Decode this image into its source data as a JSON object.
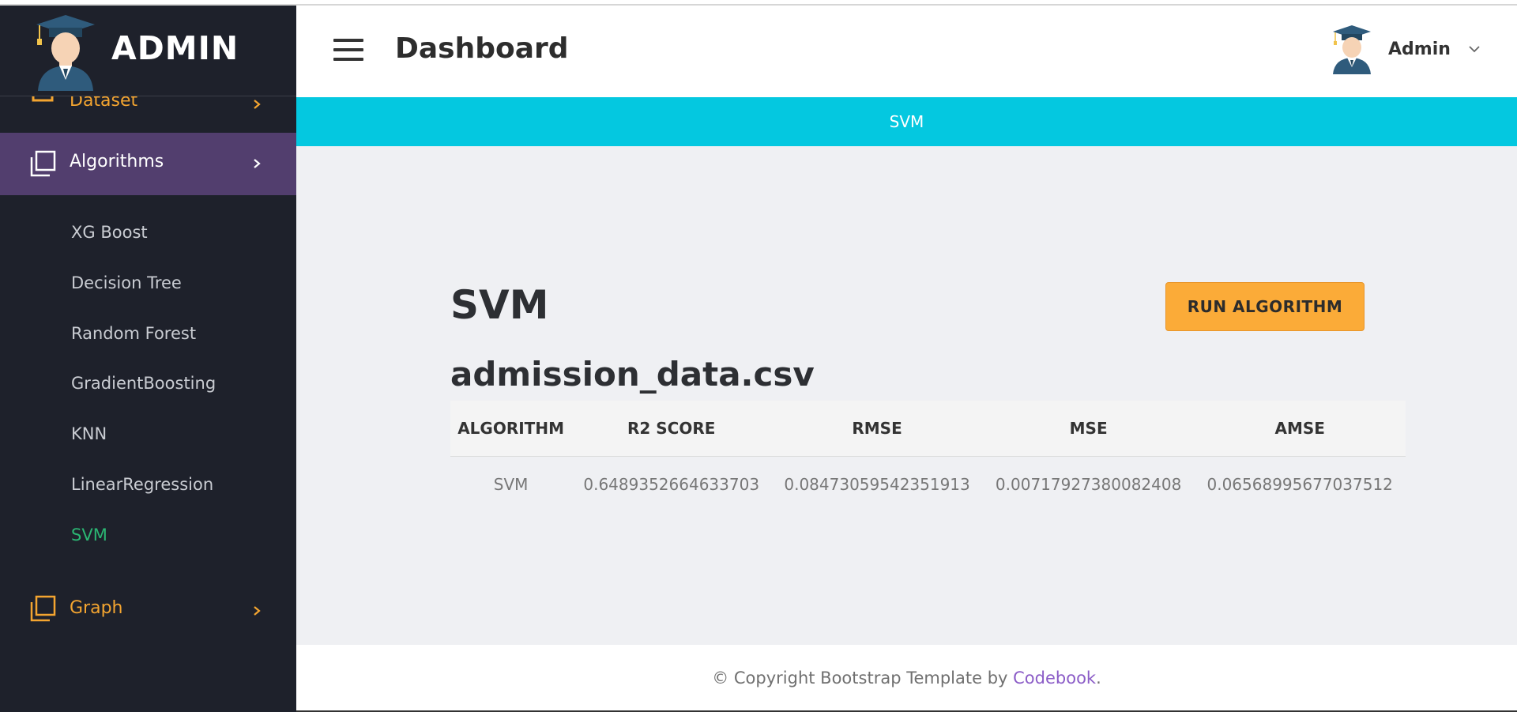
{
  "brand": {
    "name": "ADMIN"
  },
  "sidebar": {
    "dataset_label": "Dataset",
    "algorithms_label": "Algorithms",
    "algorithms_sub": [
      "XG Boost",
      "Decision Tree",
      "Random Forest",
      "GradientBoosting",
      "KNN",
      "LinearRegression",
      "SVM"
    ],
    "graph_label": "Graph"
  },
  "header": {
    "title": "Dashboard",
    "user_name": "Admin"
  },
  "banner": {
    "text": "SVM"
  },
  "main": {
    "algorithm_title": "SVM",
    "run_button": "RUN ALGORITHM",
    "dataset_name": "admission_data.csv",
    "table": {
      "headers": [
        "ALGORITHM",
        "R2 SCORE",
        "RMSE",
        "MSE",
        "AMSE"
      ],
      "rows": [
        [
          "SVM",
          "0.6489352664633703",
          "0.08473059542351913",
          "0.00717927380082408",
          "0.06568995677037512"
        ]
      ]
    }
  },
  "footer": {
    "text": "© Copyright Bootstrap Template by ",
    "link_text": "Codebook",
    "after": "."
  },
  "colors": {
    "sidebar_bg": "#1e212b",
    "active_nav_bg": "#523e6e",
    "accent_orange": "#f4a530",
    "banner_cyan": "#04c8e0",
    "active_green": "#2bb673",
    "link_purple": "#8b5cc7"
  }
}
